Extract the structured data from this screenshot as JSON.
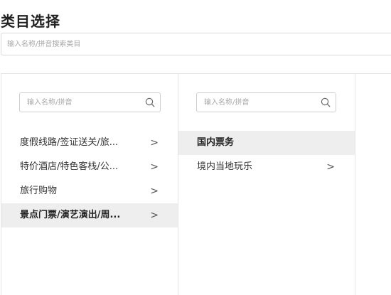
{
  "page": {
    "title": "类目选择",
    "search_placeholder": "输入名称/拼音搜索类目"
  },
  "column1": {
    "search_placeholder": "输入名称/拼音",
    "items": [
      {
        "label": "度假线路/签证送关/旅...",
        "has_children": true,
        "selected": false
      },
      {
        "label": "特价酒店/特色客栈/公...",
        "has_children": true,
        "selected": false
      },
      {
        "label": "旅行购物",
        "has_children": true,
        "selected": false
      },
      {
        "label": "景点门票/演艺演出/周...",
        "has_children": true,
        "selected": true
      }
    ]
  },
  "column2": {
    "search_placeholder": "输入名称/拼音",
    "items": [
      {
        "label": "国内票务",
        "has_children": false,
        "selected": true
      },
      {
        "label": "境内当地玩乐",
        "has_children": true,
        "selected": false
      }
    ]
  },
  "chevron_glyph": ">",
  "icons": {
    "search": "search-icon",
    "chevron": "chevron-right-icon"
  },
  "colors": {
    "selected_bg": "#eeeeee",
    "border": "#e4e4e4",
    "placeholder": "#a8a8a8"
  }
}
